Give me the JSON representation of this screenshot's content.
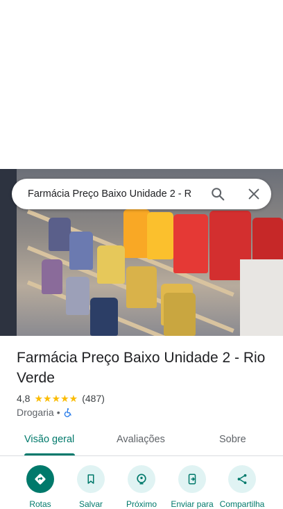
{
  "search": {
    "query": "Farmácia Preço Baixo Unidade 2 - R"
  },
  "place": {
    "title": "Farmácia Preço Baixo Unidade 2 - Rio Verde",
    "rating": "4,8",
    "stars": "★★★★★",
    "review_count": "(487)",
    "category": "Drogaria",
    "separator": "•"
  },
  "tabs": [
    {
      "label": "Visão geral",
      "active": true
    },
    {
      "label": "Avaliações",
      "active": false
    },
    {
      "label": "Sobre",
      "active": false
    }
  ],
  "actions": [
    {
      "label": "Rotas",
      "icon": "directions-icon"
    },
    {
      "label": "Salvar",
      "icon": "bookmark-icon"
    },
    {
      "label": "Próximo",
      "icon": "nearby-icon"
    },
    {
      "label": "Enviar para",
      "icon": "send-to-phone-icon"
    },
    {
      "label": "Compartilha",
      "icon": "share-icon"
    }
  ],
  "colors": {
    "accent": "#00796b",
    "star": "#fbbc04",
    "action_bg": "#e0f3f3"
  }
}
